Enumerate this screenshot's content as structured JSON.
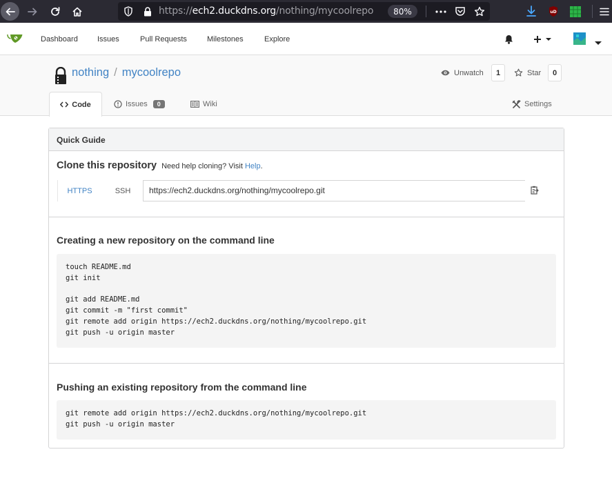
{
  "browser": {
    "url_prefix": "https://",
    "url_host": "ech2.duckdns.org",
    "url_path": "/nothing/mycoolrepo",
    "zoom": "80%"
  },
  "nav": {
    "items": [
      "Dashboard",
      "Issues",
      "Pull Requests",
      "Milestones",
      "Explore"
    ]
  },
  "repo": {
    "owner": "nothing",
    "separator": "/",
    "name": "mycoolrepo",
    "watch_label": "Unwatch",
    "watch_count": "1",
    "star_label": "Star",
    "star_count": "0",
    "tabs": {
      "code": "Code",
      "issues": "Issues",
      "issues_count": "0",
      "wiki": "Wiki",
      "settings": "Settings"
    }
  },
  "guide": {
    "header": "Quick Guide",
    "clone_title": "Clone this repository",
    "clone_help_prefix": "Need help cloning? Visit",
    "clone_help_link": "Help",
    "clone_help_suffix": ".",
    "protocols": [
      "HTTPS",
      "SSH"
    ],
    "clone_url": "https://ech2.duckdns.org/nothing/mycoolrepo.git",
    "new_repo_title": "Creating a new repository on the command line",
    "new_repo_code": [
      "touch README.md",
      "git init",
      "",
      "git add README.md",
      "git commit -m \"first commit\"",
      "git remote add origin https://ech2.duckdns.org/nothing/mycoolrepo.git",
      "git push -u origin master"
    ],
    "push_existing_title": "Pushing an existing repository from the command line",
    "push_existing_code": [
      "git remote add origin https://ech2.duckdns.org/nothing/mycoolrepo.git",
      "git push -u origin master"
    ]
  },
  "colors": {
    "link": "#4183c4",
    "browser_chrome": "#2b2a33",
    "gitea_green": "#609926"
  },
  "icons": {
    "browser": [
      "back-arrow-icon",
      "forward-arrow-icon",
      "reload-icon",
      "home-icon",
      "shield-icon",
      "lock-icon",
      "more-dots-icon",
      "pocket-icon",
      "star-bookmark-icon",
      "download-icon",
      "ublock-icon",
      "extension-icon",
      "menu-icon"
    ],
    "nav": [
      "gitea-logo",
      "bell-icon",
      "plus-icon",
      "avatar-icon"
    ],
    "repo": [
      "lock-icon",
      "eye-icon",
      "star-icon",
      "code-icon",
      "issue-icon",
      "wiki-icon",
      "settings-icon",
      "clipboard-icon"
    ]
  }
}
